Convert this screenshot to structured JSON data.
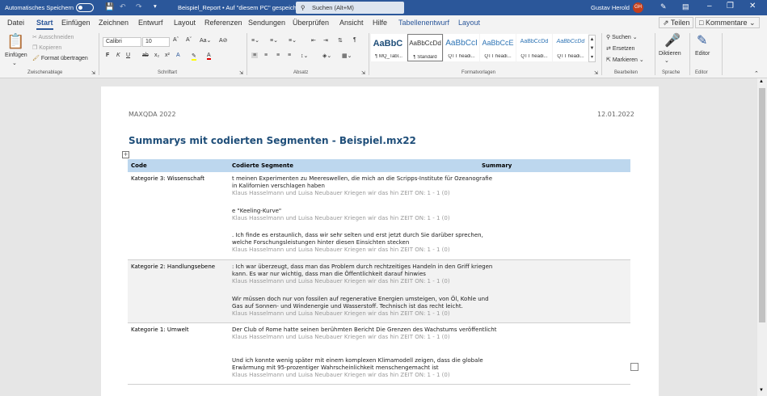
{
  "titlebar": {
    "autosave": "Automatisches Speichern",
    "doc_title": "Beispiel_Report • Auf \"diesem PC\" gespeichert",
    "search_placeholder": "Suchen (Alt+M)",
    "user": "Gustav Herold",
    "initials": "GH"
  },
  "tabs": [
    "Datei",
    "Start",
    "Einfügen",
    "Zeichnen",
    "Entwurf",
    "Layout",
    "Referenzen",
    "Sendungen",
    "Überprüfen",
    "Ansicht",
    "Hilfe",
    "Tabellenentwurf",
    "Layout"
  ],
  "share": "Teilen",
  "comments": "Kommentare",
  "ribbon": {
    "clipboard": {
      "paste": "Einfügen",
      "cut": "Ausschneiden",
      "copy": "Kopieren",
      "format": "Format übertragen",
      "label": "Zwischenablage"
    },
    "font": {
      "name": "Calibri",
      "size": "10",
      "label": "Schriftart"
    },
    "paragraph": {
      "label": "Absatz"
    },
    "styles": {
      "label": "Formatvorlagen",
      "items": [
        {
          "preview": "AaBbC ",
          "name": "¶ MQ_Tabl..."
        },
        {
          "preview": "AaBbCcDd",
          "name": "¶ Standard"
        },
        {
          "preview": "AaBbCcI",
          "name": "QTT headi..."
        },
        {
          "preview": "AaBbCcE",
          "name": "QTT headi..."
        },
        {
          "preview": "AaBbCcDd",
          "name": "QTT headi..."
        },
        {
          "preview": "AaBbCcDd",
          "name": "QTT headi..."
        }
      ]
    },
    "editing": {
      "find": "Suchen",
      "replace": "Ersetzen",
      "select": "Markieren",
      "label": "Bearbeiten"
    },
    "dictate": "Diktieren",
    "speech_label": "Sprache",
    "editor": "Editor",
    "editor_label": "Editor"
  },
  "document": {
    "header_left": "MAXQDA 2022",
    "header_right": "12.01.2022",
    "title": "Summarys mit codierten Segmenten - Beispiel.mx22",
    "columns": [
      "Code",
      "Codierte Segmente",
      "Summary"
    ],
    "rows": [
      {
        "code": "Kategorie 3: Wissenschaft",
        "segments": [
          {
            "text": "t meinen Experimenten zu Meereswellen, die mich an die Scripps-Institute für Ozeanografie in Kalifornien verschlagen haben",
            "source": "Klaus Hasselmann und Luisa Neubauer Kriegen wir das hin ZEIT ON: 1 - 1  (0)"
          },
          {
            "text": "e \"Keeling-Kurve\"",
            "source": "Klaus Hasselmann und Luisa Neubauer Kriegen wir das hin ZEIT ON: 1 - 1  (0)"
          },
          {
            "text": ". Ich finde es erstaunlich, dass wir  sehr selten und erst jetzt durch Sie darüber sprechen, welche Forschungsleistungen hinter diesen Einsichten  stecken",
            "source": "Klaus Hasselmann und Luisa Neubauer Kriegen wir das hin ZEIT ON: 1 - 1  (0)"
          }
        ]
      },
      {
        "code": "Kategorie 2: Handlungsebene",
        "segments": [
          {
            "text": ": Ich war überzeugt, dass man das Problem durch rechtzeitiges Handeln in den Griff kriegen  kann. Es war nur wichtig, dass man die Öffentlichkeit darauf hinwies",
            "source": "Klaus Hasselmann und Luisa Neubauer Kriegen wir das hin ZEIT ON: 1 - 1  (0)"
          },
          {
            "text": "Wir müssen doch nur von fossilen auf regenerative Energien umsteigen, von Öl, Kohle und Gas auf Sonnen- und  Windenergie und Wasserstoff. Technisch ist das recht leicht.",
            "source": "Klaus Hasselmann und Luisa Neubauer Kriegen wir das hin ZEIT ON: 1 - 1  (0)"
          }
        ]
      },
      {
        "code": "Kategorie 1: Umwelt",
        "segments": [
          {
            "text": "Der Club of Rome hatte seinen berühmten Bericht Die Grenzen des  Wachstums veröffentlicht",
            "source": "Klaus Hasselmann und Luisa Neubauer Kriegen wir das hin ZEIT ON: 1 - 1  (0)"
          },
          {
            "text": "Und ich konnte wenig später mit einem komplexen Klimamodell zeigen, dass die  globale Erwärmung mit 95-prozentiger Wahrscheinlichkeit menschengemacht ist",
            "source": "Klaus Hasselmann und Luisa Neubauer Kriegen wir das hin ZEIT ON: 1 - 1  (0)"
          }
        ]
      }
    ]
  }
}
